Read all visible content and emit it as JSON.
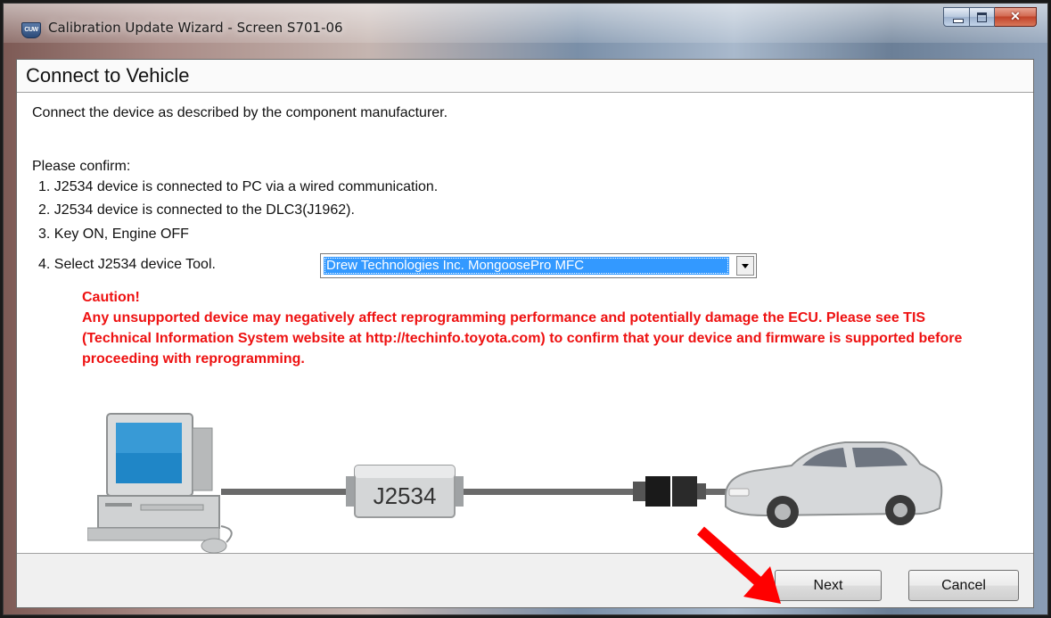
{
  "window": {
    "title": "Calibration Update Wizard - Screen S701-06",
    "app_icon_text": "CUW"
  },
  "page": {
    "title": "Connect to Vehicle",
    "intro": "Connect the device as described by the component manufacturer.",
    "confirm_label": "Please confirm:",
    "steps": [
      "1. J2534 device is connected to PC via a wired communication.",
      "2. J2534 device is connected to the DLC3(J1962).",
      "3. Key ON, Engine OFF",
      "4. Select J2534 device Tool."
    ],
    "device_select": {
      "selected": "Drew Technologies Inc. MongoosePro MFC"
    },
    "caution_title": "Caution!",
    "caution_body": "Any unsupported device may negatively affect reprogramming performance and potentially damage the ECU.  Please see TIS (Technical Information System website at http://techinfo.toyota.com) to confirm that your device and firmware is supported before proceeding with reprogramming."
  },
  "illustration": {
    "device_label": "J2534",
    "icons": [
      "computer-icon",
      "j2534-device-icon",
      "connector-icon",
      "car-icon"
    ]
  },
  "buttons": {
    "next": "Next",
    "cancel": "Cancel"
  },
  "colors": {
    "caution": "#ee1111",
    "selection": "#3399ff",
    "arrow": "#ff0000"
  }
}
